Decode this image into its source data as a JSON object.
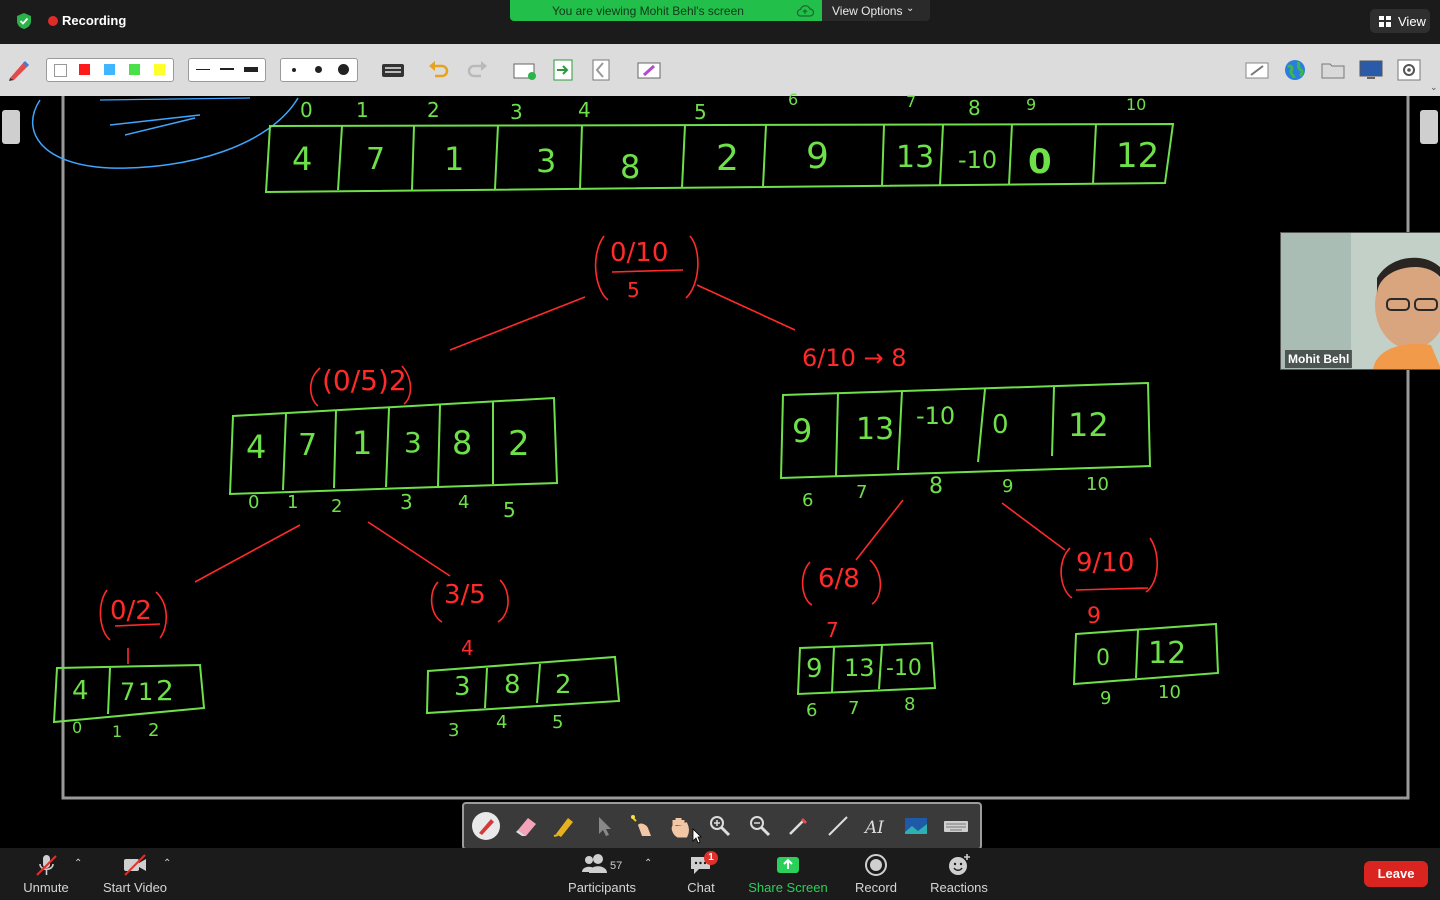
{
  "top": {
    "recording_label": "Recording",
    "viewing_banner": "You are viewing Mohit Behl's screen",
    "view_options_label": "View Options",
    "view_button_label": "View"
  },
  "annotation_toolbar": {
    "colors": [
      "#ffffff",
      "#ff1a1a",
      "#3fb6ff",
      "#49e049",
      "#ffff2a"
    ],
    "icons": [
      "pen-icon",
      "line-width-thin-icon",
      "line-width-medium-icon",
      "line-width-thick-icon",
      "dot-small-icon",
      "dot-medium-icon",
      "dot-large-icon",
      "keyboard-icon",
      "undo-icon",
      "redo-icon",
      "new-page-icon",
      "export-page-icon",
      "page-icon",
      "clear-icon",
      "edit-icon",
      "globe-icon",
      "folder-icon",
      "screen-icon",
      "settings-icon"
    ]
  },
  "whiteboard": {
    "top_indices": [
      "0",
      "1",
      "2",
      "3",
      "4",
      "5",
      "6",
      "7",
      "8",
      "9",
      "10"
    ],
    "top_array": [
      "4",
      "7",
      "1",
      "3",
      "8",
      "2",
      "9",
      "13",
      "-10",
      "0",
      "12"
    ],
    "root_range": "0/10",
    "root_mid": "5",
    "left_range": "(0/5)2",
    "left_array": [
      "4",
      "7",
      "1",
      "3",
      "8",
      "2"
    ],
    "left_indices": [
      "0",
      "1",
      "2",
      "3",
      "4",
      "5"
    ],
    "right_range": "6/10 → 8",
    "right_array": [
      "9",
      "13",
      "-10",
      "0",
      "12"
    ],
    "right_indices": [
      "6",
      "7",
      "8",
      "9",
      "10"
    ],
    "ll_range": "0/2",
    "ll_array": [
      "4",
      "7",
      "1",
      "2"
    ],
    "ll_indices": [
      "0",
      "1",
      "2"
    ],
    "lr_range": "3/5",
    "lr_mid": "4",
    "lr_array": [
      "3",
      "8",
      "2"
    ],
    "lr_indices": [
      "3",
      "4",
      "5"
    ],
    "rl_range": "6/8",
    "rl_mid": "7",
    "rl_array": [
      "9",
      "13",
      "-10"
    ],
    "rl_indices": [
      "6",
      "7",
      "8"
    ],
    "rr_range": "9/10",
    "rr_mid": "9",
    "rr_array": [
      "0",
      "12"
    ],
    "rr_indices": [
      "9",
      "10"
    ]
  },
  "participant": {
    "name": "Mohit Behl"
  },
  "drawing_toolbar": {
    "tools": [
      "pen-tool-icon",
      "eraser-icon",
      "highlighter-icon",
      "pointer-icon",
      "magic-wand-icon",
      "hand-icon",
      "zoom-in-icon",
      "zoom-out-icon",
      "brush-icon",
      "line-icon",
      "text-icon",
      "picture-icon",
      "keyboard-icon"
    ]
  },
  "meeting_bar": {
    "unmute": "Unmute",
    "start_video": "Start Video",
    "participants": "Participants",
    "participant_count": "57",
    "chat": "Chat",
    "chat_badge": "1",
    "share_screen": "Share Screen",
    "record": "Record",
    "reactions": "Reactions",
    "leave": "Leave"
  }
}
